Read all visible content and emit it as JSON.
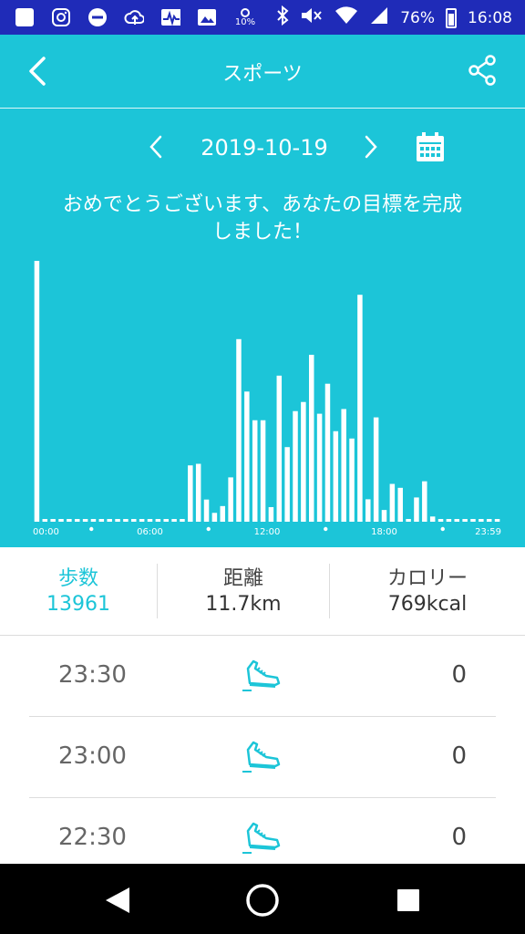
{
  "status_bar": {
    "weather_temp": "10%",
    "battery_percent": "76%",
    "time": "16:08",
    "icons": [
      "app-square-icon",
      "instagram-icon",
      "minus-circle-icon",
      "cloud-upload-icon",
      "activity-icon",
      "image-icon",
      "weather-icon",
      "bluetooth-icon",
      "mute-icon",
      "wifi-icon",
      "signal-icon",
      "battery-icon"
    ]
  },
  "header": {
    "title": "スポーツ",
    "date": "2019-10-19",
    "message_line1": "おめでとうございます、あなたの目標を完成",
    "message_line2": "しました！"
  },
  "chart_data": {
    "type": "bar",
    "x_tick_labels": [
      "00:00",
      "06:00",
      "12:00",
      "18:00",
      "23:59"
    ],
    "values": [
      1000,
      5,
      0,
      0,
      0,
      0,
      0,
      0,
      0,
      0,
      0,
      0,
      0,
      0,
      0,
      0,
      0,
      0,
      0,
      216,
      222,
      85,
      34,
      60,
      170,
      700,
      499,
      389,
      389,
      56,
      560,
      286,
      424,
      459,
      640,
      414,
      529,
      347,
      432,
      319,
      870,
      86,
      400,
      45,
      145,
      130,
      0,
      93,
      155,
      20,
      0,
      0,
      0,
      0,
      0,
      0,
      0,
      0
    ],
    "ylim": [
      0,
      1000
    ],
    "colors": {
      "bars": "#ffffff",
      "background": "#1cc5d8"
    }
  },
  "stats": {
    "steps_label": "歩数",
    "steps_value": "13961",
    "distance_label": "距離",
    "distance_value": "11.7km",
    "calories_label": "カロリー",
    "calories_value": "769kcal"
  },
  "records": [
    {
      "time": "23:30",
      "steps": "0"
    },
    {
      "time": "23:00",
      "steps": "0"
    },
    {
      "time": "22:30",
      "steps": "0"
    }
  ],
  "colors": {
    "accent": "#1cc5d8",
    "status_bar": "#1f2bb8"
  }
}
